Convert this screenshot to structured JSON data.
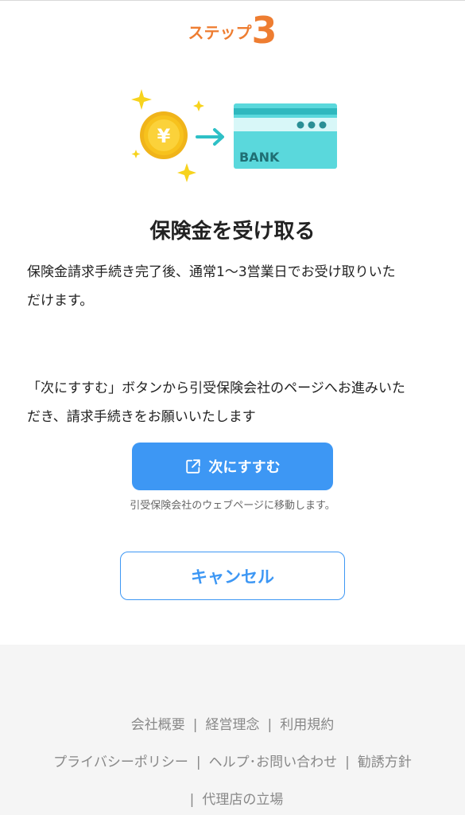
{
  "step": {
    "label": "ステップ",
    "number": "3"
  },
  "illustration": {
    "bank_text": "BANK",
    "yen_symbol": "¥"
  },
  "title": "保険金を受け取る",
  "description1_line1": "保険金請求手続き完了後、通常1〜3営業日でお受け取りいた",
  "description1_line2": "だけます。",
  "description2_line1": "「次にすすむ」ボタンから引受保険会社のページへお進みいた",
  "description2_line2": "だき、請求手続きをお願いいたします",
  "next_button_label": "次にすすむ",
  "move_note": "引受保険会社のウェブページに移動します。",
  "cancel_button_label": "キャンセル",
  "footer": {
    "company_overview": "会社概要",
    "management_philosophy": "経営理念",
    "terms": "利用規約",
    "privacy_policy": "プライバシーポリシー",
    "help_contact": "ヘルプ･お問い合わせ",
    "solicitation_policy": "勧誘方針",
    "agency_position": "代理店の立場",
    "separator": "|"
  },
  "colors": {
    "accent": "#3d97f4",
    "step": "#ee7d31",
    "coin": "#f7c21d",
    "card": "#5ad8dc"
  }
}
